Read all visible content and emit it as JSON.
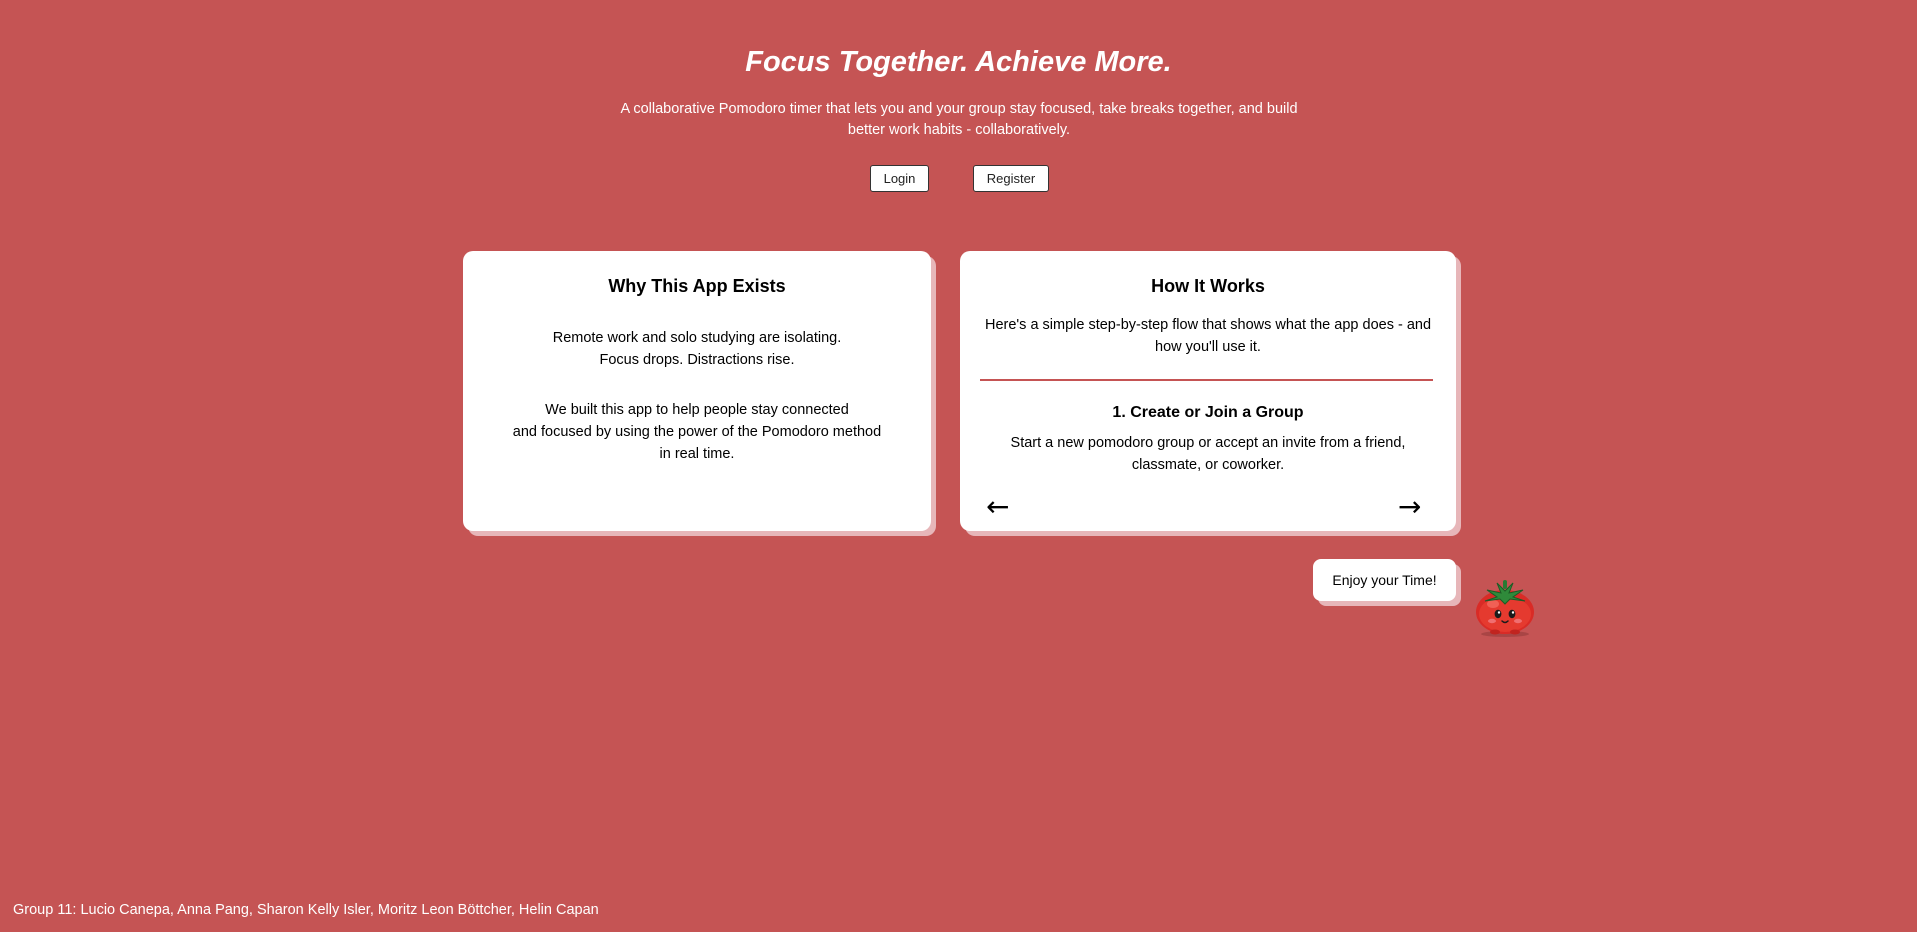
{
  "hero": {
    "title": "Focus Together. Achieve More.",
    "subtitle_line1": "A collaborative Pomodoro timer that lets you and your group stay focused, take breaks together, and build",
    "subtitle_line2": "better work habits - collaboratively."
  },
  "auth": {
    "login_label": "Login",
    "register_label": "Register"
  },
  "why_card": {
    "title": "Why This App Exists",
    "para1": [
      "Remote work and solo studying are isolating.",
      "Focus drops. Distractions rise."
    ],
    "para2": [
      "We built this app to help people stay connected",
      "and focused by using the power of the Pomodoro method",
      "in real time."
    ]
  },
  "how_card": {
    "title": "How It Works",
    "intro_line1": "Here's a simple step-by-step flow that shows what the app does - and",
    "intro_line2": "how you'll use it.",
    "step": {
      "title": "1. Create or Join a Group",
      "desc_line1": "Start a new pomodoro group or accept an invite from a friend,",
      "desc_line2": "classmate, or coworker."
    },
    "prev_icon": "←",
    "next_icon": "→"
  },
  "mascot": {
    "speech": "Enjoy your Time!",
    "icon": "tomato-mascot-icon"
  },
  "footer": {
    "credits": "Group 11: Lucio Canepa, Anna Pang, Sharon Kelly Isler, Moritz Leon Böttcher, Helin Capan"
  },
  "colors": {
    "background": "#c55454",
    "card": "#ffffff",
    "card_shadow": "#e7b6b9"
  }
}
